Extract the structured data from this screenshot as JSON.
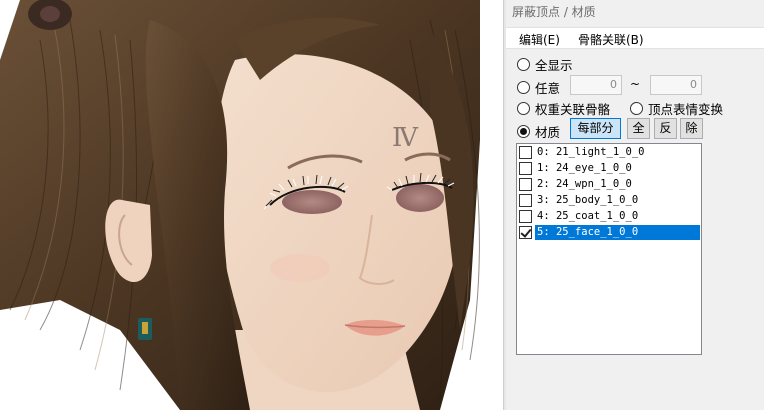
{
  "window": {
    "title": "屏蔽顶点 / 材质"
  },
  "menu": {
    "edit": "编辑(E)",
    "bone_link": "骨骼关联(B)"
  },
  "options": {
    "show_all": "全显示",
    "arbitrary": "任意",
    "range_from": "0",
    "range_to": "0",
    "range_sep": "~",
    "weight_bones": "权重关联骨骼",
    "vertex_morph": "顶点表情变换",
    "material": "材质",
    "selected": "material"
  },
  "material_buttons": {
    "per_part": "每部分",
    "all": "全",
    "invert": "反",
    "remove": "除"
  },
  "materials": [
    {
      "label": "0: 21_light_1_0_0",
      "checked": false,
      "selected": false
    },
    {
      "label": "1: 24_eye_1_0_0",
      "checked": false,
      "selected": false
    },
    {
      "label": "2: 24_wpn_1_0_0",
      "checked": false,
      "selected": false
    },
    {
      "label": "3: 25_body_1_0_0",
      "checked": false,
      "selected": false
    },
    {
      "label": "4: 25_coat_1_0_0",
      "checked": false,
      "selected": false
    },
    {
      "label": "5: 25_face_1_0_0",
      "checked": true,
      "selected": true
    }
  ],
  "viewport": {
    "forehead_mark": "Ⅳ"
  },
  "colors": {
    "selection": "#0078d7",
    "hair": "#4a3522",
    "skin": "#efd6c3"
  }
}
